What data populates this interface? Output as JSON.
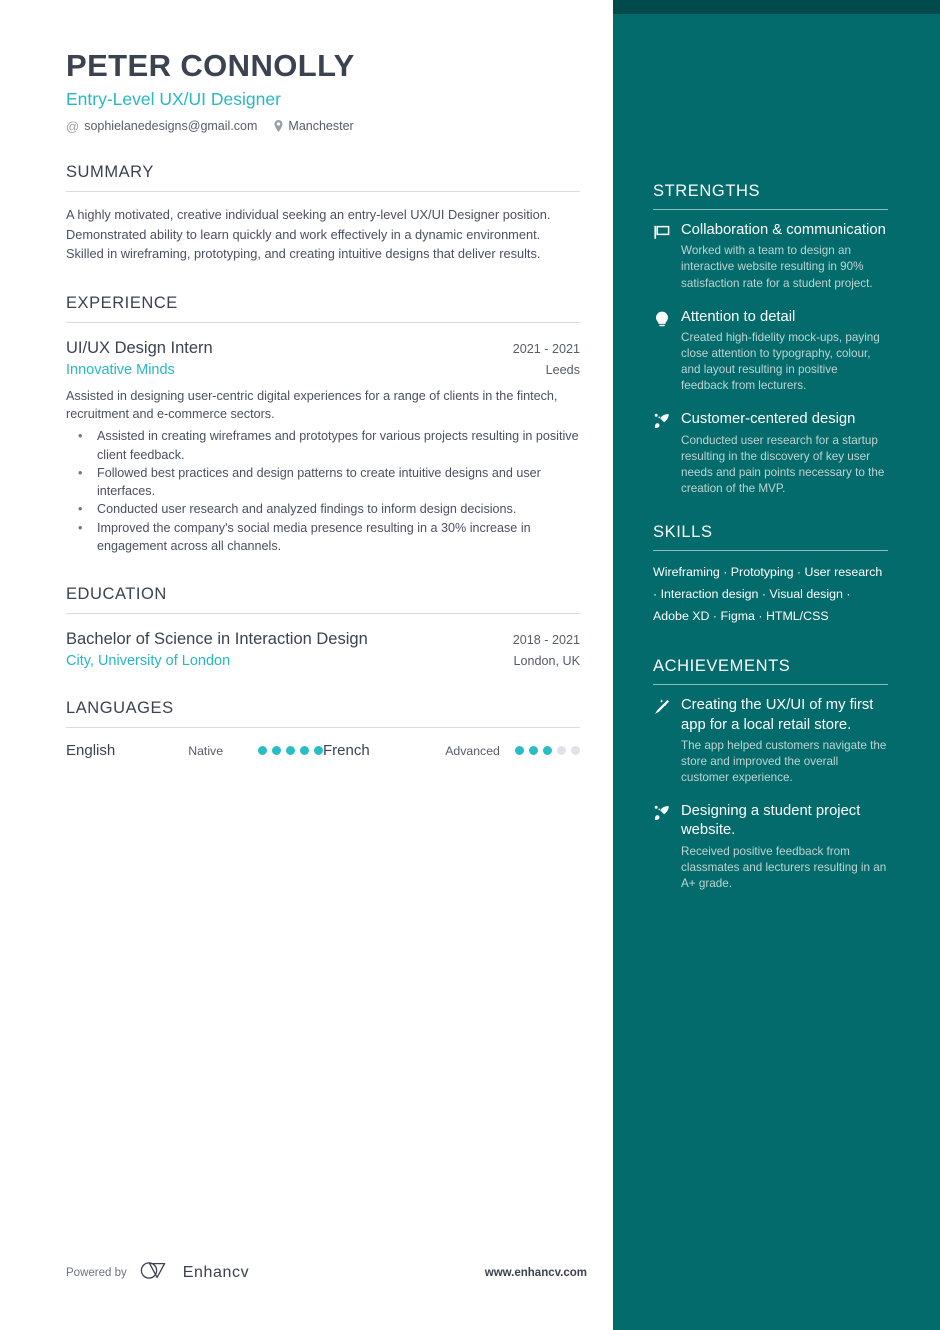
{
  "header": {
    "name": "PETER CONNOLLY",
    "job_title": "Entry-Level UX/UI Designer",
    "email": "sophielanedesigns@gmail.com",
    "email_icon": "at-icon",
    "location": "Manchester",
    "location_icon": "map-pin-icon"
  },
  "summary": {
    "title": "SUMMARY",
    "text": "A highly motivated, creative individual seeking an entry-level UX/UI Designer position. Demonstrated ability to learn quickly and work effectively in a dynamic environment. Skilled in wireframing, prototyping, and creating intuitive designs that deliver results."
  },
  "experience": {
    "title": "EXPERIENCE",
    "entries": [
      {
        "role": "UI/UX Design Intern",
        "date": "2021 - 2021",
        "company": "Innovative Minds",
        "location": "Leeds",
        "description": "Assisted in designing user-centric digital experiences for a range of clients in the fintech, recruitment and e-commerce sectors.",
        "bullets": [
          "Assisted in creating wireframes and prototypes for various projects resulting in positive client feedback.",
          "Followed best practices and design patterns to create intuitive designs and user interfaces.",
          "Conducted user research and analyzed findings to inform design decisions.",
          "Improved the company's social media presence resulting in a 30% increase in engagement across all channels."
        ]
      }
    ]
  },
  "education": {
    "title": "EDUCATION",
    "entries": [
      {
        "degree": "Bachelor of Science in Interaction Design",
        "date": "2018 - 2021",
        "school": "City, University of London",
        "location": "London, UK"
      }
    ]
  },
  "languages": {
    "title": "LANGUAGES",
    "items": [
      {
        "name": "English",
        "level": "Native",
        "filled": 5,
        "total": 5
      },
      {
        "name": "French",
        "level": "Advanced",
        "filled": 3,
        "total": 5
      }
    ]
  },
  "strengths": {
    "title": "STRENGTHS",
    "items": [
      {
        "icon": "flag-icon",
        "title": "Collaboration & communication",
        "description": "Worked with a team to design an interactive website resulting in 90% satisfaction rate for a student project."
      },
      {
        "icon": "lightbulb-icon",
        "title": "Attention to detail",
        "description": "Created high-fidelity mock-ups, paying close attention to typography, colour, and layout resulting in positive feedback from lecturers."
      },
      {
        "icon": "rocket-icon",
        "title": "Customer-centered design",
        "description": "Conducted user research for a startup resulting in the discovery of key user needs and pain points necessary to the creation of the MVP."
      }
    ]
  },
  "skills": {
    "title": "SKILLS",
    "items": [
      "Wireframing",
      "Prototyping",
      "User research",
      "Interaction design",
      "Visual design",
      "Adobe XD",
      "Figma",
      "HTML/CSS"
    ],
    "separator": "·"
  },
  "achievements": {
    "title": "ACHIEVEMENTS",
    "items": [
      {
        "icon": "magic-wand-icon",
        "title": "Creating the UX/UI of my first app for a local retail store.",
        "description": "The app helped customers navigate the store and improved the overall customer experience."
      },
      {
        "icon": "rocket-icon",
        "title": "Designing a student project website.",
        "description": "Received positive feedback from classmates and lecturers resulting in an A+ grade."
      }
    ]
  },
  "footer": {
    "powered_by": "Powered by",
    "brand": "Enhancv",
    "brand_icon": "enhancv-logo-icon",
    "url": "www.enhancv.com"
  },
  "colors": {
    "sidebar_bg": "#036b6b",
    "sidebar_top_band": "#014a4c",
    "accent_teal": "#26b8c4",
    "heading_dark": "#3b4250",
    "body_text": "#4a5060",
    "dot_filled": "#29bdc4",
    "dot_empty": "#dfe2e6"
  }
}
